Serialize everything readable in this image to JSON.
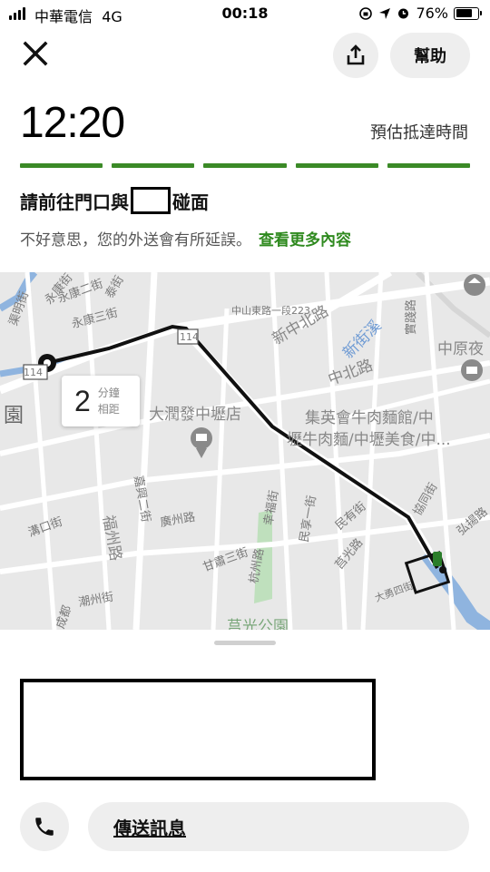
{
  "status_bar": {
    "carrier": "中華電信",
    "network": "4G",
    "time": "00:18",
    "battery": "76%",
    "battery_level": 0.76
  },
  "header": {
    "close_icon": "close-icon",
    "share_icon": "share-icon",
    "help_label": "幫助"
  },
  "eta": {
    "time": "12:20",
    "label": "預估抵達時間",
    "progress_segments": 5,
    "accent_color": "#3b8a27"
  },
  "meet": {
    "prefix": "請前往門口與",
    "suffix": "碰面"
  },
  "delay": {
    "text": "不好意思，您的外送會有所延誤。",
    "link": "查看更多內容"
  },
  "map": {
    "distance_value": "2",
    "distance_unit_top": "分鐘",
    "distance_unit_bottom": "相距",
    "labels": {
      "place_store": "大潤發中壢店",
      "place_restaurant_1": "集英會牛肉麵館/中",
      "place_restaurant_2": "壢牛肉麵/中壢美食/中...",
      "place_park": "莒光公園",
      "place_zhongyuan": "中原夜",
      "area_yuan": "園",
      "road_zhongshan": "中山東路一段223",
      "road_xinzhongbei": "新中北路",
      "road_zhongbei": "中北路",
      "road_xinjiexi": "新街溪",
      "road_shijian": "實踐路",
      "road_yongkang2": "永康二街",
      "road_yongkang3": "永康三街",
      "road_yongkang": "永康街",
      "road_taigu": "泰街",
      "road_fuzhou": "福州路",
      "road_guangzhou": "廣州路",
      "road_hangzhou": "杭州路",
      "road_jiayu": "嘉興二街",
      "road_minyou": "民有街",
      "road_minheng": "民享一街",
      "road_juguang": "莒光路",
      "road_xiehe": "協同街",
      "road_hongyang": "弘揚路",
      "road_dayong": "大勇四街",
      "road_xinghua": "幸福街",
      "road_gantang": "甘肅三街",
      "road_chaozhou": "潮州街",
      "road_chengdu": "成都",
      "road_puqing": "溝口街",
      "road_shen": "渠明街",
      "route_114": "114",
      "route_114b": "114"
    }
  },
  "sheet": {
    "phone_icon": "phone-icon",
    "message_label": "傳送訊息"
  }
}
